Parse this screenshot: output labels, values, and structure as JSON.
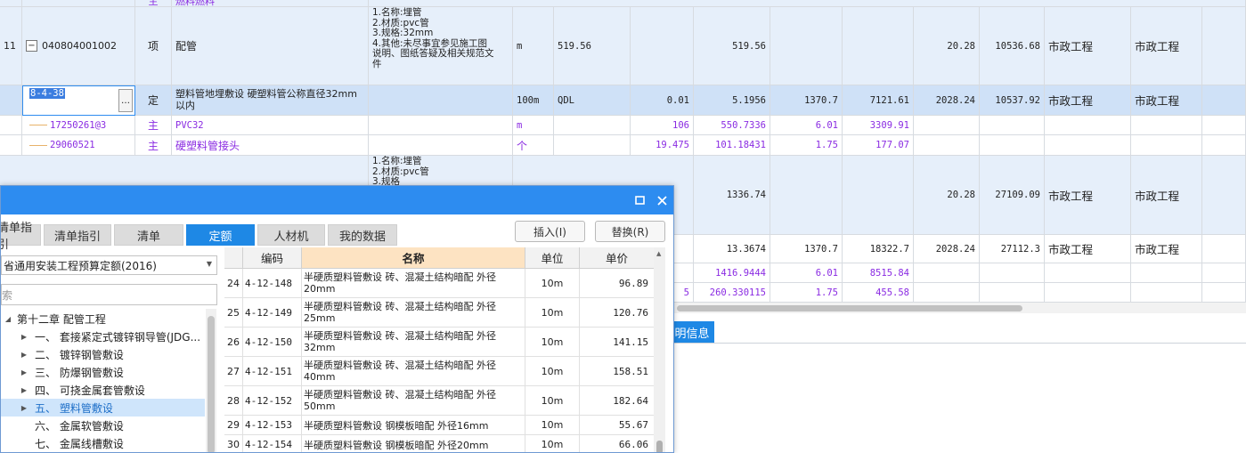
{
  "grid": {
    "row_top_partial": {
      "unit_frag": "主",
      "name_frag": "燃料燃料"
    },
    "row_11": {
      "index": "11",
      "code": "040804001002",
      "type": "项",
      "name": "配管",
      "features": [
        "1.名称:埋管",
        "2.材质:pvc管",
        "3.规格:32mm",
        "4.其他:未尽事宜参见施工图",
        "说明、图纸答疑及相关规范文",
        "件"
      ],
      "unit": "m",
      "qty": "519.56",
      "qty2": "519.56",
      "price": "20.28",
      "total": "10536.68",
      "cat1": "市政工程",
      "cat2": "市政工程"
    },
    "row_quota": {
      "code": "8-4-38",
      "more": "…",
      "type": "定",
      "name": "塑料管地埋敷设 硬塑料管公称直径32mm以内",
      "unit": "100m",
      "expr": "QDL",
      "ratio": "0.01",
      "qty": "5.1956",
      "unit_price": "1370.7",
      "amount": "7121.61",
      "price": "2028.24",
      "total": "10537.92",
      "cat1": "市政工程",
      "cat2": "市政工程"
    },
    "row_mat1": {
      "code": "17250261@3",
      "type": "主",
      "name": "PVC32",
      "unit": "m",
      "ratio": "106",
      "qty": "550.7336",
      "unit_price": "6.01",
      "amount": "3309.91"
    },
    "row_mat2": {
      "code": "29060521",
      "type": "主",
      "name": "硬塑料管接头",
      "unit": "个",
      "ratio": "19.475",
      "qty": "101.18431",
      "unit_price": "1.75",
      "amount": "177.07"
    },
    "row_12": {
      "features": [
        "1.名称:埋管",
        "2.材质:pvc管",
        "3.规格"
      ],
      "qty2": "1336.74",
      "price": "20.28",
      "total": "27109.09",
      "cat1": "市政工程",
      "cat2": "市政工程"
    },
    "row_quota2": {
      "qty": "13.3674",
      "unit_price": "1370.7",
      "amount": "18322.7",
      "price": "2028.24",
      "total": "27112.3",
      "cat1": "市政工程",
      "cat2": "市政工程"
    },
    "row_mat3": {
      "qty": "1416.9444",
      "unit_price": "6.01",
      "amount": "8515.84"
    },
    "row_mat4": {
      "ratio_frag": "5",
      "qty": "260.330115",
      "unit_price": "1.75",
      "amount": "455.58"
    },
    "detail_tab": "明信息"
  },
  "dialog": {
    "tabs": [
      "清单指引",
      "清单指引",
      "清单",
      "定额",
      "人材机",
      "我的数据"
    ],
    "active_tab": "定额",
    "insert_btn": "插入(I)",
    "replace_btn": "替换(R)",
    "quota_lib": "省通用安装工程预算定额(2016)",
    "search_text": "索",
    "tree": [
      {
        "label": "第十二章 配管工程",
        "expanded": true
      },
      {
        "label": "一、 套接紧定式镀锌钢导管(JDG..."
      },
      {
        "label": "二、 镀锌钢管敷设"
      },
      {
        "label": "三、 防爆钢管敷设"
      },
      {
        "label": "四、 可挠金属套管敷设"
      },
      {
        "label": "五、 塑料管敷设",
        "selected": true
      },
      {
        "label": "六、 金属软管敷设"
      },
      {
        "label": "七、 金属线槽敷设"
      }
    ],
    "table": {
      "headers": {
        "code": "编码",
        "name": "名称",
        "unit": "单位",
        "price": "单价"
      },
      "rows": [
        {
          "no": "24",
          "code": "4-12-148",
          "name": "半硬质塑料管敷设 砖、混凝土结构暗配 外径20mm",
          "unit": "10m",
          "price": "96.89"
        },
        {
          "no": "25",
          "code": "4-12-149",
          "name": "半硬质塑料管敷设 砖、混凝土结构暗配 外径25mm",
          "unit": "10m",
          "price": "120.76"
        },
        {
          "no": "26",
          "code": "4-12-150",
          "name": "半硬质塑料管敷设 砖、混凝土结构暗配 外径32mm",
          "unit": "10m",
          "price": "141.15"
        },
        {
          "no": "27",
          "code": "4-12-151",
          "name": "半硬质塑料管敷设 砖、混凝土结构暗配 外径40mm",
          "unit": "10m",
          "price": "158.51"
        },
        {
          "no": "28",
          "code": "4-12-152",
          "name": "半硬质塑料管敷设 砖、混凝土结构暗配 外径50mm",
          "unit": "10m",
          "price": "182.64"
        },
        {
          "no": "29",
          "code": "4-12-153",
          "name": "半硬质塑料管敷设 钢模板暗配 外径16mm",
          "unit": "10m",
          "price": "55.67"
        },
        {
          "no": "30",
          "code": "4-12-154",
          "name": "半硬质塑料管敷设 钢模板暗配 外径20mm",
          "unit": "10m",
          "price": "66.06"
        }
      ]
    }
  },
  "colors": {
    "accent": "#1e88e5",
    "title_bar": "#2d8cf0",
    "purple_text": "#8a2be2",
    "selected_row": "#cfe1f7"
  }
}
